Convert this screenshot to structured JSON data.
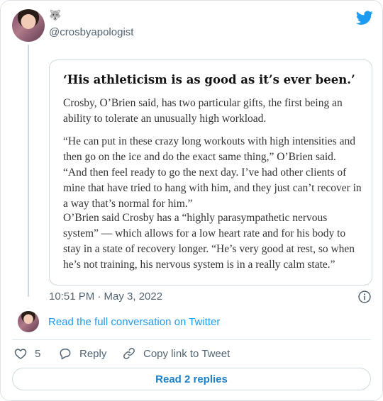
{
  "tweet": {
    "emoji": "🐺",
    "handle": "@crosbyapologist",
    "timestamp": "10:51 PM · May 3, 2022"
  },
  "quote_card": {
    "title": "‘His athleticism is as good as it’s ever been.’",
    "paragraphs": [
      "Crosby, O’Brien said, has two particular gifts, the first being an ability to tolerate an unusually high workload.",
      "“He can put in these crazy long workouts with high intensities and then go on the ice and do the exact same thing,” O’Brien said. “And then feel ready to go the next day. I’ve had other clients of mine that have tried to hang with him, and they just can’t recover in a way that’s normal for him.”",
      "O’Brien said Crosby has a “highly parasympathetic nervous system” — which allows for a low heart rate and for his body to stay in a state of recovery longer. “He’s very good at rest, so when he’s not training, his nervous system is in a really calm state.”"
    ]
  },
  "conversation_link": "Read the full conversation on Twitter",
  "actions": {
    "like_count": "5",
    "reply_label": "Reply",
    "copy_label": "Copy link to Tweet"
  },
  "replies_button": "Read 2 replies",
  "colors": {
    "accent": "#1d9bf0",
    "muted": "#536471",
    "border": "#cfd9de"
  }
}
